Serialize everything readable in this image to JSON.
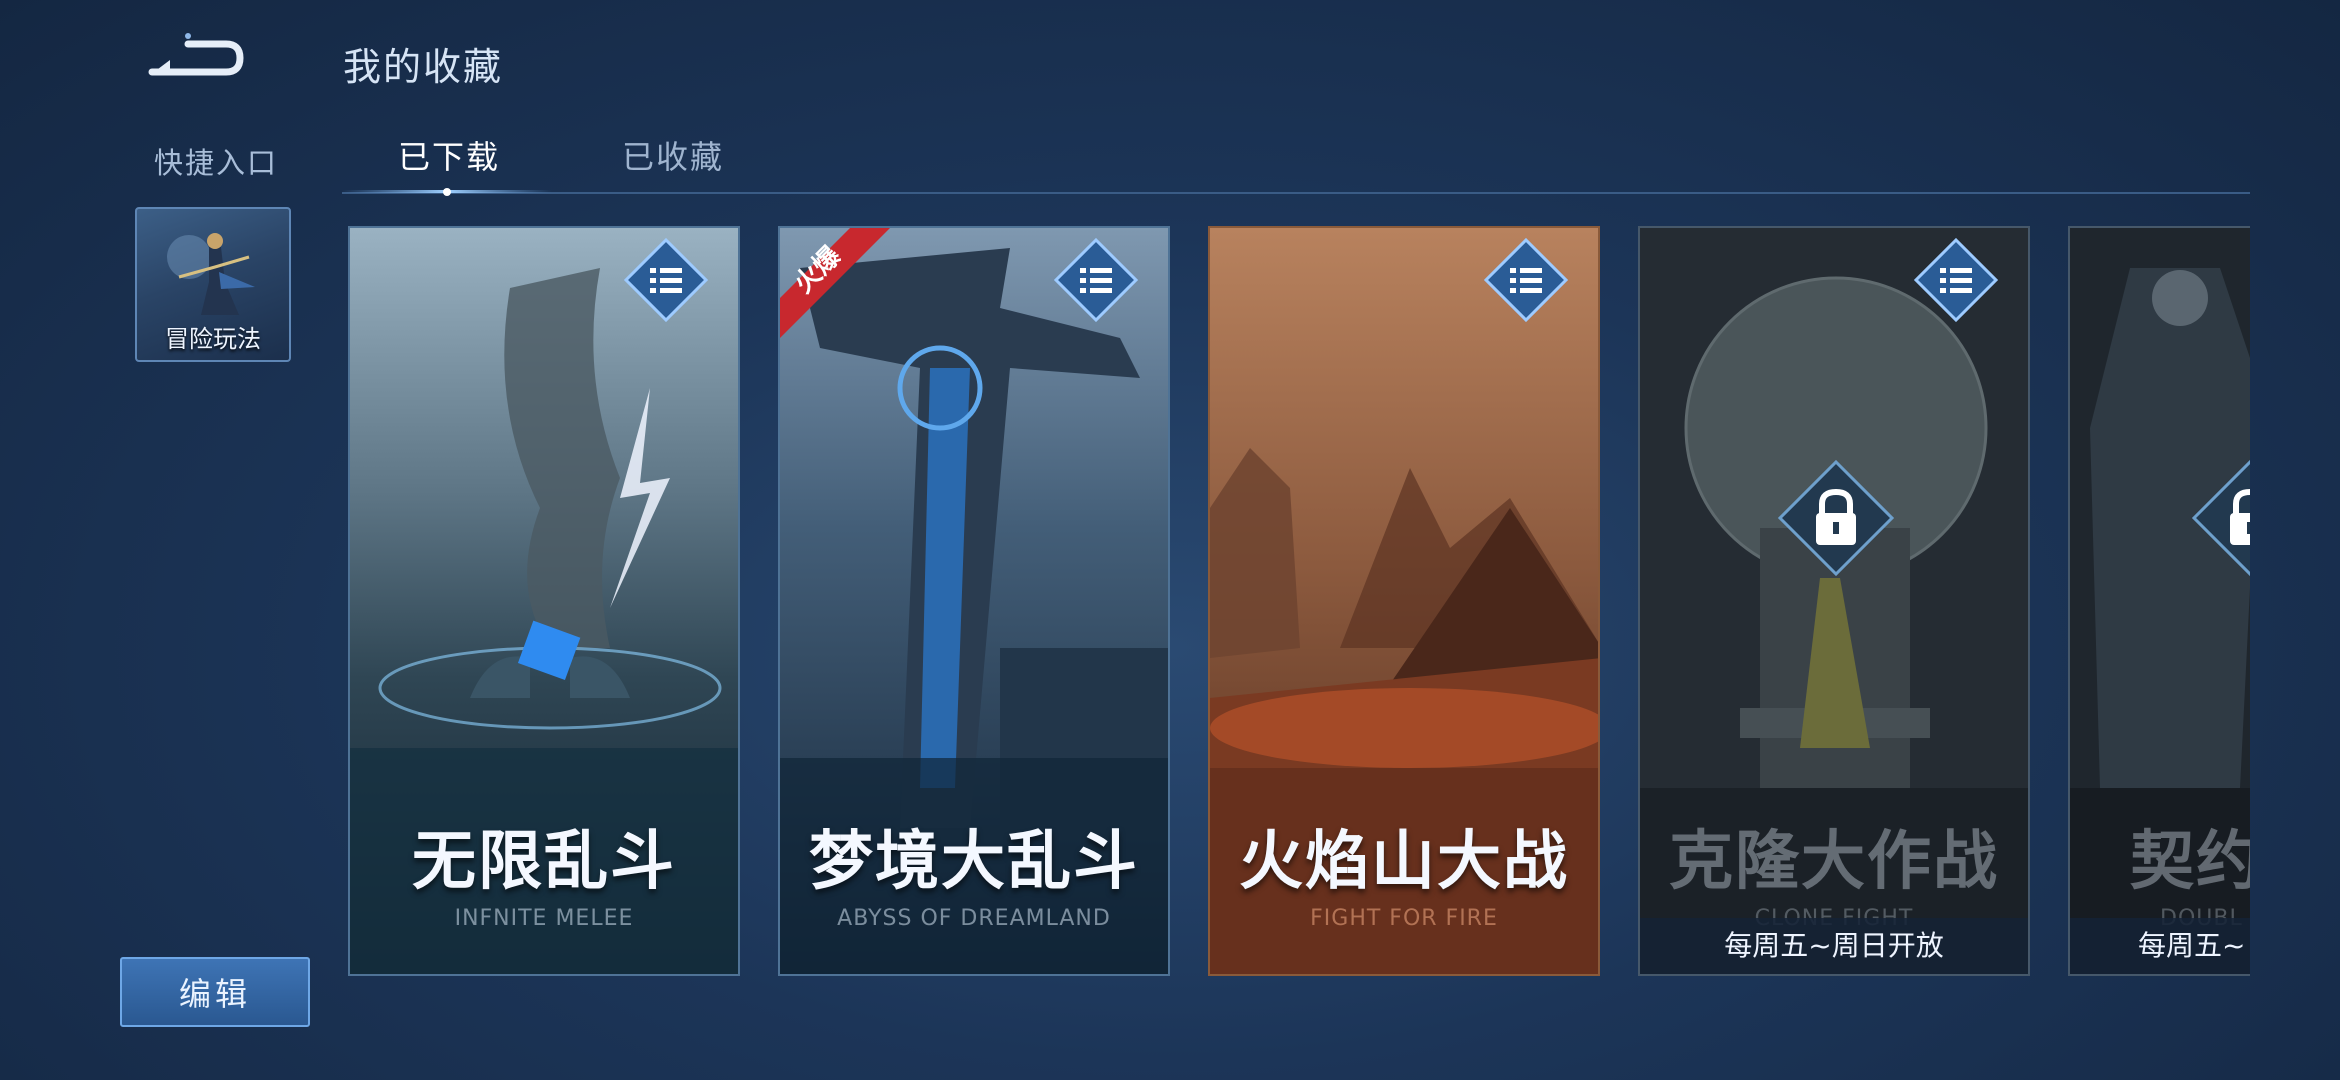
{
  "header": {
    "title": "我的收藏",
    "back_icon": "back-arrow-icon"
  },
  "sidebar": {
    "quick_entry_label": "快捷入口",
    "quick_tile": {
      "label": "冒险玩法"
    },
    "edit_button": "编辑"
  },
  "tabs": [
    {
      "label": "已下载",
      "active": true
    },
    {
      "label": "已收藏",
      "active": false
    }
  ],
  "cards": [
    {
      "title": "无限乱斗",
      "subtitle": "INFNITE MELEE",
      "badge": "",
      "locked": false,
      "schedule": ""
    },
    {
      "title": "梦境大乱斗",
      "subtitle": "ABYSS OF DREAMLAND",
      "badge": "火爆",
      "locked": false,
      "schedule": ""
    },
    {
      "title": "火焰山大战",
      "subtitle": "FIGHT FOR FIRE",
      "badge": "",
      "locked": false,
      "schedule": ""
    },
    {
      "title": "克隆大作战",
      "subtitle": "CLONE FIGHT",
      "badge": "",
      "locked": true,
      "schedule": "每周五~周日开放"
    },
    {
      "title": "契约",
      "subtitle": "DOUBL",
      "badge": "",
      "locked": true,
      "schedule": "每周五~"
    }
  ],
  "colors": {
    "background": "#1c3558",
    "accent": "#6ea7e6",
    "hot_badge": "#c8282e"
  }
}
